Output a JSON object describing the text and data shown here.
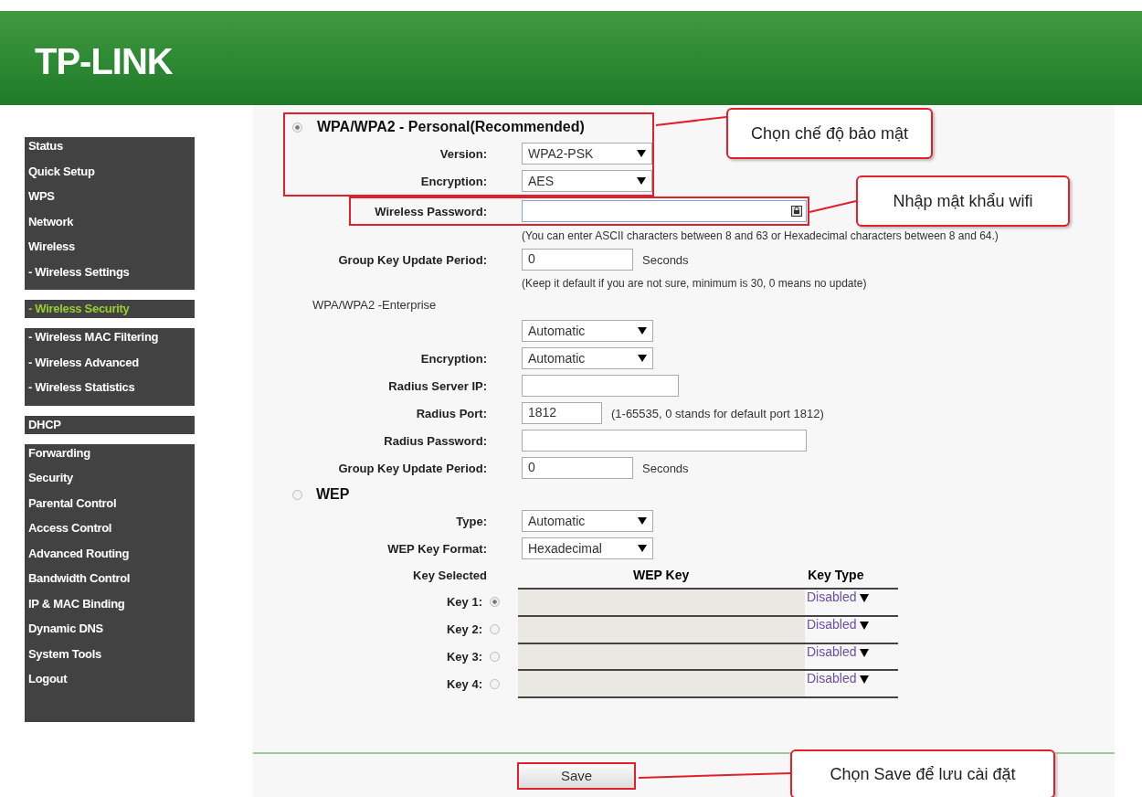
{
  "header": {
    "logo": "TP-LINK"
  },
  "sidebar": {
    "groups": [
      {
        "items": [
          {
            "label": "Status",
            "selected": false
          },
          {
            "label": "Quick Setup",
            "selected": false
          },
          {
            "label": "WPS",
            "selected": false
          },
          {
            "label": "Network",
            "selected": false
          },
          {
            "label": "Wireless",
            "selected": false
          },
          {
            "label": "- Wireless Settings",
            "selected": false
          }
        ]
      },
      {
        "items": [
          {
            "label": "- Wireless Security",
            "selected": true
          }
        ]
      },
      {
        "items": [
          {
            "label": "- Wireless MAC Filtering",
            "selected": false
          },
          {
            "label": "- Wireless Advanced",
            "selected": false
          },
          {
            "label": "- Wireless Statistics",
            "selected": false
          }
        ]
      },
      {
        "items": [
          {
            "label": "DHCP",
            "selected": false
          }
        ]
      },
      {
        "items": [
          {
            "label": "Forwarding",
            "selected": false
          },
          {
            "label": "Security",
            "selected": false
          },
          {
            "label": "Parental Control",
            "selected": false
          },
          {
            "label": "Access Control",
            "selected": false
          },
          {
            "label": "Advanced Routing",
            "selected": false
          },
          {
            "label": "Bandwidth Control",
            "selected": false
          },
          {
            "label": "IP & MAC Binding",
            "selected": false
          },
          {
            "label": "Dynamic DNS",
            "selected": false
          },
          {
            "label": "System Tools",
            "selected": false
          },
          {
            "label": "Logout",
            "selected": false
          }
        ]
      }
    ]
  },
  "wpa_personal": {
    "title": "WPA/WPA2 - Personal(Recommended)",
    "selected": true,
    "fields": [
      {
        "kind": "select",
        "label": "Version:",
        "value": "WPA2-PSK"
      },
      {
        "kind": "select",
        "label": "Encryption:",
        "value": "AES"
      },
      {
        "kind": "password",
        "label": "Wireless Password:"
      },
      {
        "kind": "note",
        "text": "(You can enter ASCII characters between 8 and 63 or Hexadecimal characters between 8 and 64.)"
      },
      {
        "kind": "input",
        "label": "Group Key Update Period:",
        "value": "0",
        "unit": "Seconds"
      },
      {
        "kind": "note",
        "text": "(Keep it default if you are not sure, minimum is 30, 0 means no update)"
      }
    ]
  },
  "wpa_enterprise": {
    "title": "WPA/WPA2 -Enterprise",
    "fields": [
      {
        "kind": "select",
        "value": "Automatic"
      },
      {
        "kind": "select",
        "label": "Encryption:",
        "value": "Automatic"
      },
      {
        "kind": "long_input",
        "label": "Radius Server IP:"
      },
      {
        "kind": "port",
        "label": "Radius Port:",
        "value": "1812",
        "unit": "(1-65535, 0 stands for default port 1812)"
      },
      {
        "kind": "wide_input",
        "label": "Radius Password:"
      },
      {
        "kind": "input",
        "label": "Group Key Update Period:",
        "value": "0",
        "unit": "Seconds"
      }
    ]
  },
  "wep": {
    "title": "WEP",
    "selected": false,
    "fields": [
      {
        "kind": "select",
        "label": "Type:",
        "value": "Automatic"
      },
      {
        "kind": "select",
        "label": "WEP Key Format:",
        "value": "Hexadecimal"
      }
    ],
    "key_columns": [
      "Key Selected",
      "WEP Key",
      "Key Type"
    ],
    "keys": [
      {
        "label": "Key 1:",
        "selected": true,
        "key_type": "Disabled"
      },
      {
        "label": "Key 2:",
        "selected": false,
        "key_type": "Disabled"
      },
      {
        "label": "Key 3:",
        "selected": false,
        "key_type": "Disabled"
      },
      {
        "label": "Key 4:",
        "selected": false,
        "key_type": "Disabled"
      }
    ]
  },
  "save_button": "Save",
  "callouts": [
    {
      "text": "Chọn chế độ bảo mật"
    },
    {
      "text": "Nhập mật khẩu wifi"
    },
    {
      "text": "Chọn Save để lưu cài đặt"
    }
  ]
}
